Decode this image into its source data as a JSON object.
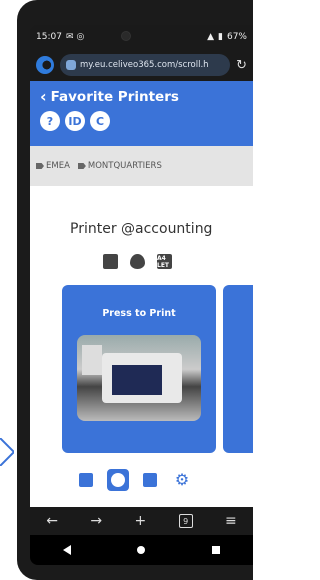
{
  "status_bar": {
    "time": "15:07",
    "battery": "67%"
  },
  "browser": {
    "url": "my.eu.celiveo365.com/scroll.h",
    "tabs_count": "9"
  },
  "header": {
    "back_title": "Favorite Printers",
    "icons": [
      "?",
      "ID",
      "C"
    ]
  },
  "tags": [
    "EMEA",
    "MONTQUARTIERS"
  ],
  "printer": {
    "name": "Printer @accounting",
    "features": [
      "printer-feature-icon",
      "color-drop-icon",
      "paper-size-icon"
    ],
    "paper_sizes": "A4 LET",
    "card_label": "Press to Print"
  },
  "bottom_tabs": [
    "list-tab",
    "color-tab",
    "print-settings-tab",
    "gear-tab"
  ],
  "colors": {
    "accent": "#3b73d8",
    "tagbar": "#e4e4e4",
    "frame": "#1b1b1b"
  }
}
